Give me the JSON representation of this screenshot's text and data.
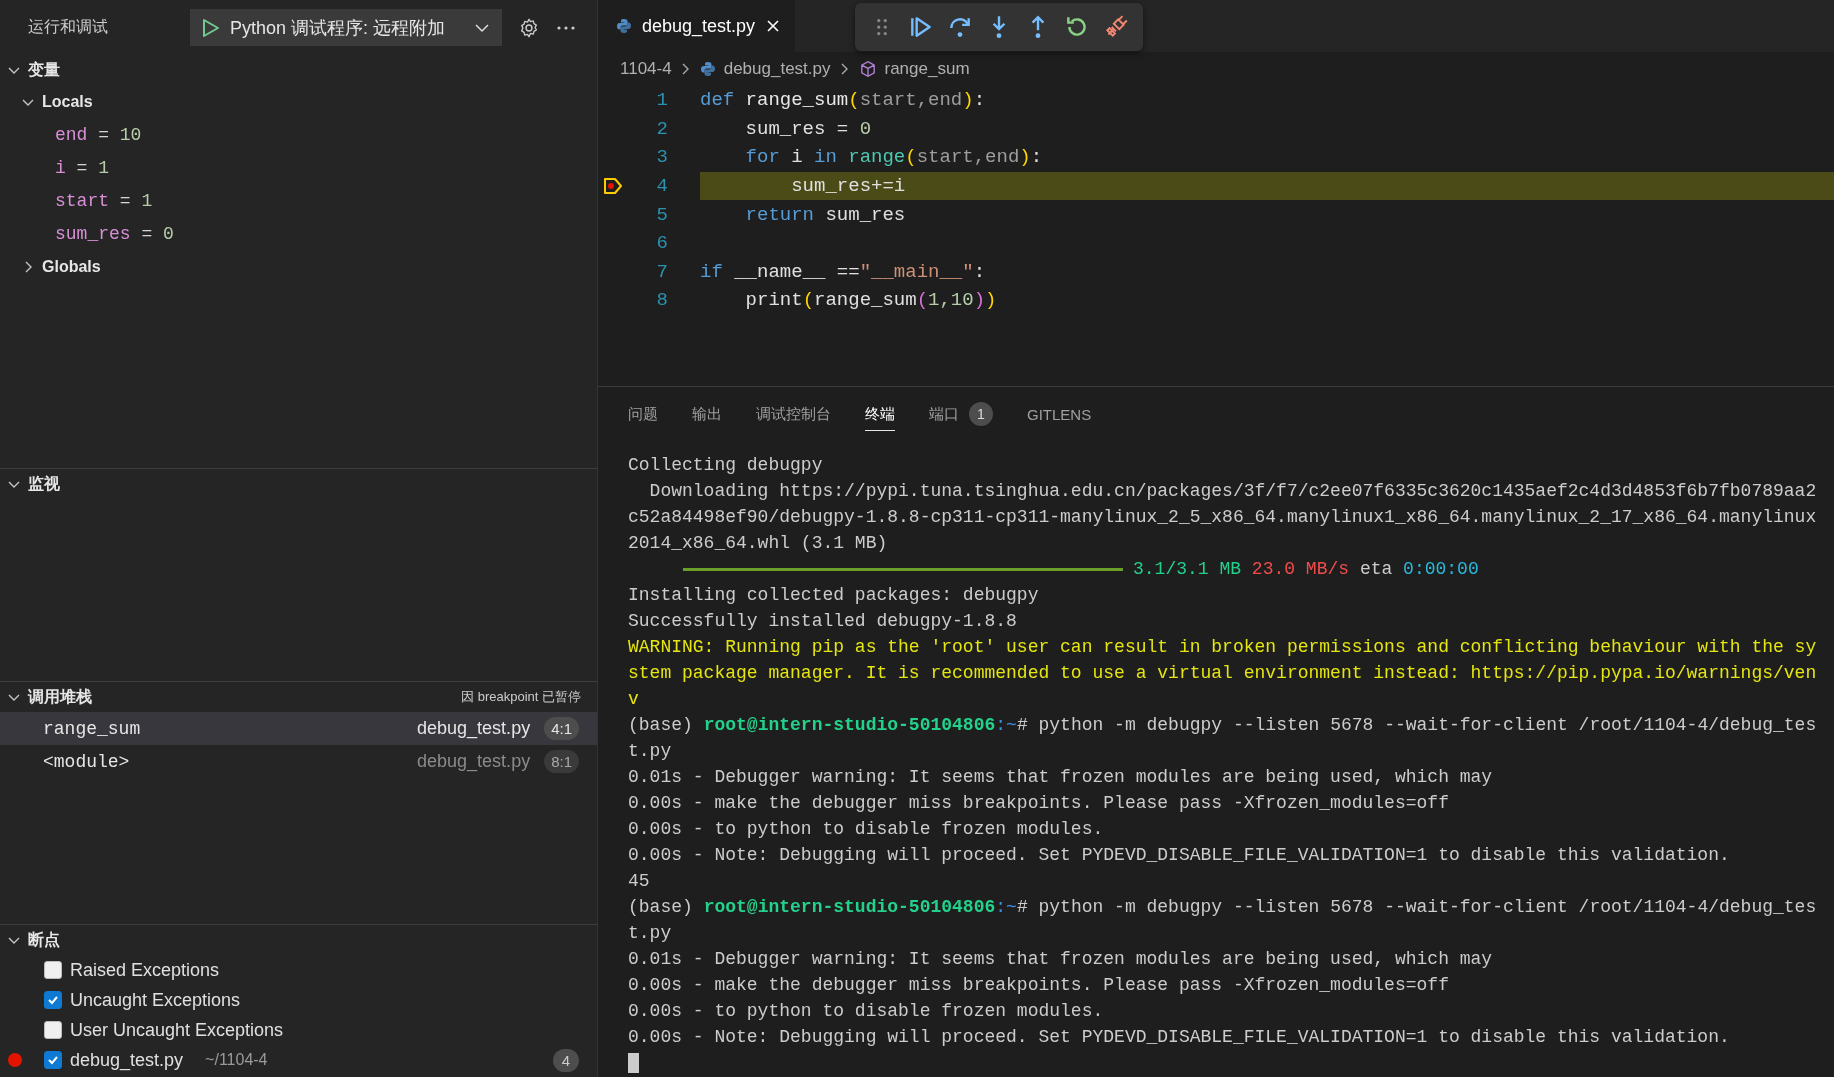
{
  "sidebar": {
    "title": "运行和调试",
    "launch_config": "Python 调试程序: 远程附加"
  },
  "variables": {
    "title": "变量",
    "expanded": true,
    "scopes": [
      {
        "name": "Locals",
        "expanded": true,
        "children": [
          {
            "name": "end",
            "equals": "=",
            "value": "10"
          },
          {
            "name": "i",
            "equals": "=",
            "value": "1"
          },
          {
            "name": "start",
            "equals": "=",
            "value": "1"
          },
          {
            "name": "sum_res",
            "equals": "=",
            "value": "0"
          }
        ]
      },
      {
        "name": "Globals",
        "expanded": false
      }
    ]
  },
  "watch": {
    "title": "监视",
    "expanded": true
  },
  "call_stack": {
    "title": "调用堆栈",
    "expanded": true,
    "status": "因 breakpoint 已暂停",
    "frames": [
      {
        "name": "range_sum",
        "file": "debug_test.py",
        "position": "4:1",
        "selected": true
      },
      {
        "name": "<module>",
        "file": "debug_test.py",
        "position": "8:1",
        "selected": false
      }
    ]
  },
  "breakpoints": {
    "title": "断点",
    "expanded": true,
    "items": [
      {
        "kind": "exception",
        "label": "Raised Exceptions",
        "checked": false
      },
      {
        "kind": "exception",
        "label": "Uncaught Exceptions",
        "checked": true
      },
      {
        "kind": "exception",
        "label": "User Uncaught Exceptions",
        "checked": false
      },
      {
        "kind": "file",
        "label": "debug_test.py",
        "path": "~/1104-4",
        "count": "4",
        "checked": true
      }
    ]
  },
  "editor": {
    "tab": {
      "label": "debug_test.py"
    },
    "breadcrumb": [
      {
        "kind": "folder",
        "label": "1104-4"
      },
      {
        "kind": "python-file",
        "label": "debug_test.py"
      },
      {
        "kind": "function",
        "label": "range_sum"
      }
    ],
    "lines": [
      {
        "number": "1",
        "current": false,
        "tokens": [
          {
            "kind": "keyword",
            "text": "def "
          },
          {
            "kind": "function",
            "text": "range_sum"
          },
          {
            "kind": "bracket1",
            "text": "("
          },
          {
            "kind": "parameter",
            "text": "start,end"
          },
          {
            "kind": "bracket1",
            "text": ")"
          },
          {
            "kind": "plain",
            "text": ":"
          }
        ]
      },
      {
        "number": "2",
        "current": false,
        "tokens": [
          {
            "kind": "plain",
            "text": "    sum_res = "
          },
          {
            "kind": "number",
            "text": "0"
          }
        ]
      },
      {
        "number": "3",
        "current": false,
        "tokens": [
          {
            "kind": "keyword",
            "text": "    for"
          },
          {
            "kind": "plain",
            "text": " i "
          },
          {
            "kind": "keyword",
            "text": "in"
          },
          {
            "kind": "builtin",
            "text": " range"
          },
          {
            "kind": "bracket1",
            "text": "("
          },
          {
            "kind": "parameter",
            "text": "start,end"
          },
          {
            "kind": "bracket1",
            "text": ")"
          },
          {
            "kind": "plain",
            "text": ":"
          }
        ]
      },
      {
        "number": "4",
        "current": true,
        "tokens": [
          {
            "kind": "plain",
            "text": "        sum_res+=i"
          }
        ]
      },
      {
        "number": "5",
        "current": false,
        "tokens": [
          {
            "kind": "keyword",
            "text": "    return"
          },
          {
            "kind": "plain",
            "text": " sum_res"
          }
        ]
      },
      {
        "number": "6",
        "current": false
      },
      {
        "number": "7",
        "current": false,
        "tokens": [
          {
            "kind": "keyword",
            "text": "if"
          },
          {
            "kind": "plain",
            "text": " __name__ =="
          },
          {
            "kind": "string",
            "text": "\"__main__\""
          },
          {
            "kind": "plain",
            "text": ":"
          }
        ]
      },
      {
        "number": "8",
        "current": false,
        "tokens": [
          {
            "kind": "plain",
            "text": "    print"
          },
          {
            "kind": "bracket1",
            "text": "("
          },
          {
            "kind": "plain",
            "text": "range_sum"
          },
          {
            "kind": "bracket2",
            "text": "("
          },
          {
            "kind": "number",
            "text": "1,10"
          },
          {
            "kind": "bracket2",
            "text": ")"
          },
          {
            "kind": "bracket1",
            "text": ")"
          }
        ]
      }
    ]
  },
  "panel": {
    "tabs": [
      {
        "label": "问题",
        "selected": false
      },
      {
        "label": "输出",
        "selected": false
      },
      {
        "label": "调试控制台",
        "selected": false
      },
      {
        "label": "终端",
        "selected": true
      },
      {
        "label": "端口",
        "badge": "1",
        "selected": false
      },
      {
        "label": "GITLENS",
        "selected": false
      }
    ],
    "terminal": [
      {
        "kind": "plain",
        "text": "Collecting debugpy"
      },
      {
        "kind": "plain",
        "text": "  Downloading https://pypi.tuna.tsinghua.edu.cn/packages/3f/f7/c2ee07f6335c3620c1435aef2c4d3d4853f6b7fb0789aa2"
      },
      {
        "kind": "plain",
        "text": "c52a84498ef90/debugpy-1.8.8-cp311-cp311-manylinux_2_5_x86_64.manylinux1_x86_64.manylinux_2_17_x86_64.manylinux"
      },
      {
        "kind": "plain",
        "text": "2014_x86_64.whl (3.1 MB)"
      },
      {
        "kind": "progress",
        "level": 1,
        "size": "3.1/3.1 MB",
        "speed": "23.0 MB/s",
        "eta_label": "eta",
        "eta": "0:00:00"
      },
      {
        "kind": "plain",
        "text": "Installing collected packages: debugpy"
      },
      {
        "kind": "plain",
        "text": "Successfully installed debugpy-1.8.8"
      },
      {
        "kind": "warning",
        "text": "WARNING: Running pip as the 'root' user can result in broken permissions and conflicting behaviour with the sy"
      },
      {
        "kind": "warning",
        "text": "stem package manager. It is recommended to use a virtual environment instead: https://pip.pypa.io/warnings/ven"
      },
      {
        "kind": "warning",
        "text": "v"
      },
      {
        "kind": "prompt",
        "env": "(base)",
        "user": "root@intern-studio-50104806",
        "path": ":~",
        "command": "# python -m debugpy --listen 5678 --wait-for-client /root/1104-4/debug_tes"
      },
      {
        "kind": "plain",
        "text": "t.py"
      },
      {
        "kind": "plain",
        "text": "0.01s - Debugger warning: It seems that frozen modules are being used, which may"
      },
      {
        "kind": "plain",
        "text": "0.00s - make the debugger miss breakpoints. Please pass -Xfrozen_modules=off"
      },
      {
        "kind": "plain",
        "text": "0.00s - to python to disable frozen modules."
      },
      {
        "kind": "plain",
        "text": "0.00s - Note: Debugging will proceed. Set PYDEVD_DISABLE_FILE_VALIDATION=1 to disable this validation."
      },
      {
        "kind": "plain",
        "text": "45"
      },
      {
        "kind": "prompt",
        "env": "(base)",
        "user": "root@intern-studio-50104806",
        "path": ":~",
        "command": "# python -m debugpy --listen 5678 --wait-for-client /root/1104-4/debug_tes"
      },
      {
        "kind": "plain",
        "text": "t.py"
      },
      {
        "kind": "plain",
        "text": "0.01s - Debugger warning: It seems that frozen modules are being used, which may"
      },
      {
        "kind": "plain",
        "text": "0.00s - make the debugger miss breakpoints. Please pass -Xfrozen_modules=off"
      },
      {
        "kind": "plain",
        "text": "0.00s - to python to disable frozen modules."
      },
      {
        "kind": "plain",
        "text": "0.00s - Note: Debugging will proceed. Set PYDEVD_DISABLE_FILE_VALIDATION=1 to disable this validation."
      },
      {
        "kind": "cursor"
      }
    ]
  }
}
